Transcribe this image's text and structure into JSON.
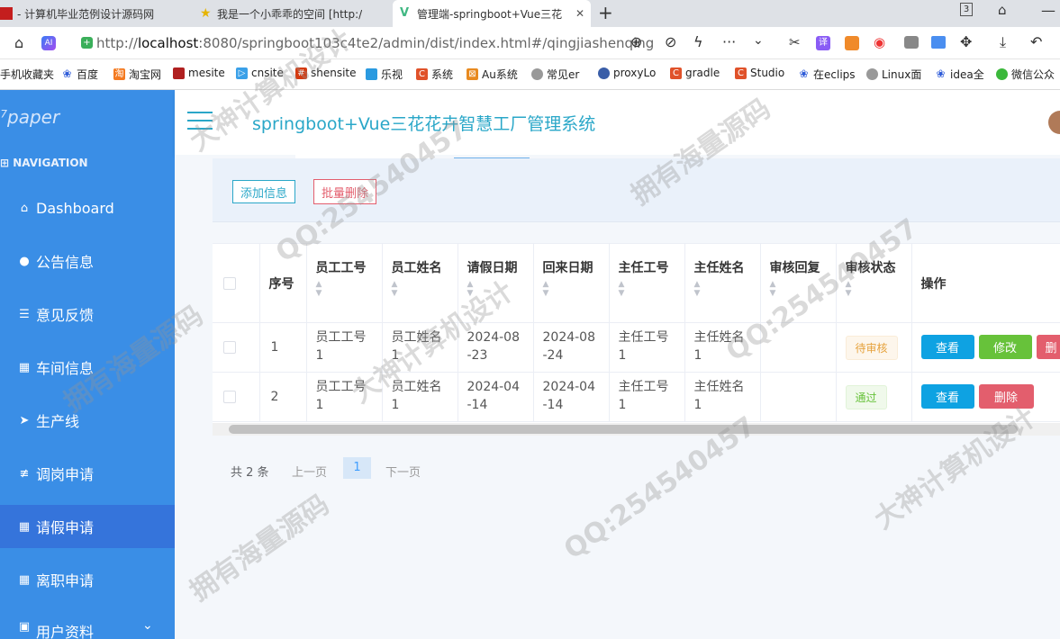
{
  "browser": {
    "tabs": [
      {
        "title": "- 计算机毕业范例设计源码网"
      },
      {
        "title": "我是一个小乖乖的空间 [http:/"
      },
      {
        "title": "管理端-springboot+Vue三花"
      }
    ],
    "tab_counter": "3",
    "url_prefix": "http://",
    "url_host": "localhost",
    "url_rest": ":8080/springboot103c4te2/admin/dist/index.html#/qingjiashenqing",
    "bookmarks": [
      "手机收藏夹",
      "百度",
      "淘宝网",
      "mesite",
      "cnsite",
      "shensite",
      "乐视",
      "系统",
      "Au系统",
      "常见er",
      "proxyLo",
      "gradle",
      "Studio",
      "在eclips",
      "Linux面",
      "idea全",
      "微信公众"
    ]
  },
  "sidebar": {
    "logo": "paper",
    "section_title": "NAVIGATION",
    "items": [
      {
        "label": "Dashboard",
        "icon": "home-icon"
      },
      {
        "label": "公告信息",
        "icon": "bulb-icon"
      },
      {
        "label": "意见反馈",
        "icon": "list-icon"
      },
      {
        "label": "车间信息",
        "icon": "grid-icon"
      },
      {
        "label": "生产线",
        "icon": "send-icon"
      },
      {
        "label": "调岗申请",
        "icon": "sliders-icon"
      },
      {
        "label": "请假申请",
        "icon": "grid-icon"
      },
      {
        "label": "离职申请",
        "icon": "grid-icon"
      },
      {
        "label": "用户资料",
        "icon": "user-icon"
      }
    ],
    "active_item": "请假申请"
  },
  "header": {
    "title": "springboot+Vue三花花卉智慧工厂管理系统"
  },
  "toolbar": {
    "add_label": "添加信息",
    "batch_delete_label": "批量删除"
  },
  "table": {
    "columns": [
      "序号",
      "员工工号",
      "员工姓名",
      "请假日期",
      "回来日期",
      "主任工号",
      "主任姓名",
      "审核回复",
      "审核状态",
      "操作"
    ],
    "rows": [
      {
        "index": "1",
        "emp_no": "员工工号1",
        "emp_name": "员工姓名1",
        "leave_date": "2024-08-23",
        "return_date": "2024-08-24",
        "dir_no": "主任工号1",
        "dir_name": "主任姓名1",
        "reply": "",
        "status": "待审核",
        "actions": [
          "查看",
          "修改",
          "删"
        ]
      },
      {
        "index": "2",
        "emp_no": "员工工号1",
        "emp_name": "员工姓名1",
        "leave_date": "2024-04-14",
        "return_date": "2024-04-14",
        "dir_no": "主任工号1",
        "dir_name": "主任姓名1",
        "reply": "",
        "status": "通过",
        "actions": [
          "查看",
          "删除"
        ]
      }
    ]
  },
  "pagination": {
    "total": "共 2 条",
    "prev": "上一页",
    "current": "1",
    "next": "下一页"
  },
  "watermark": {
    "texts": [
      "大神计算机设计",
      "拥有海量源码",
      "QQ:254540457"
    ]
  },
  "colors": {
    "sidebar": "#3a8ee6",
    "header_title": "#2aa7c8",
    "view_btn": "#0ea2e2",
    "edit_btn": "#67c23a",
    "delete_btn": "#e35e6d"
  }
}
